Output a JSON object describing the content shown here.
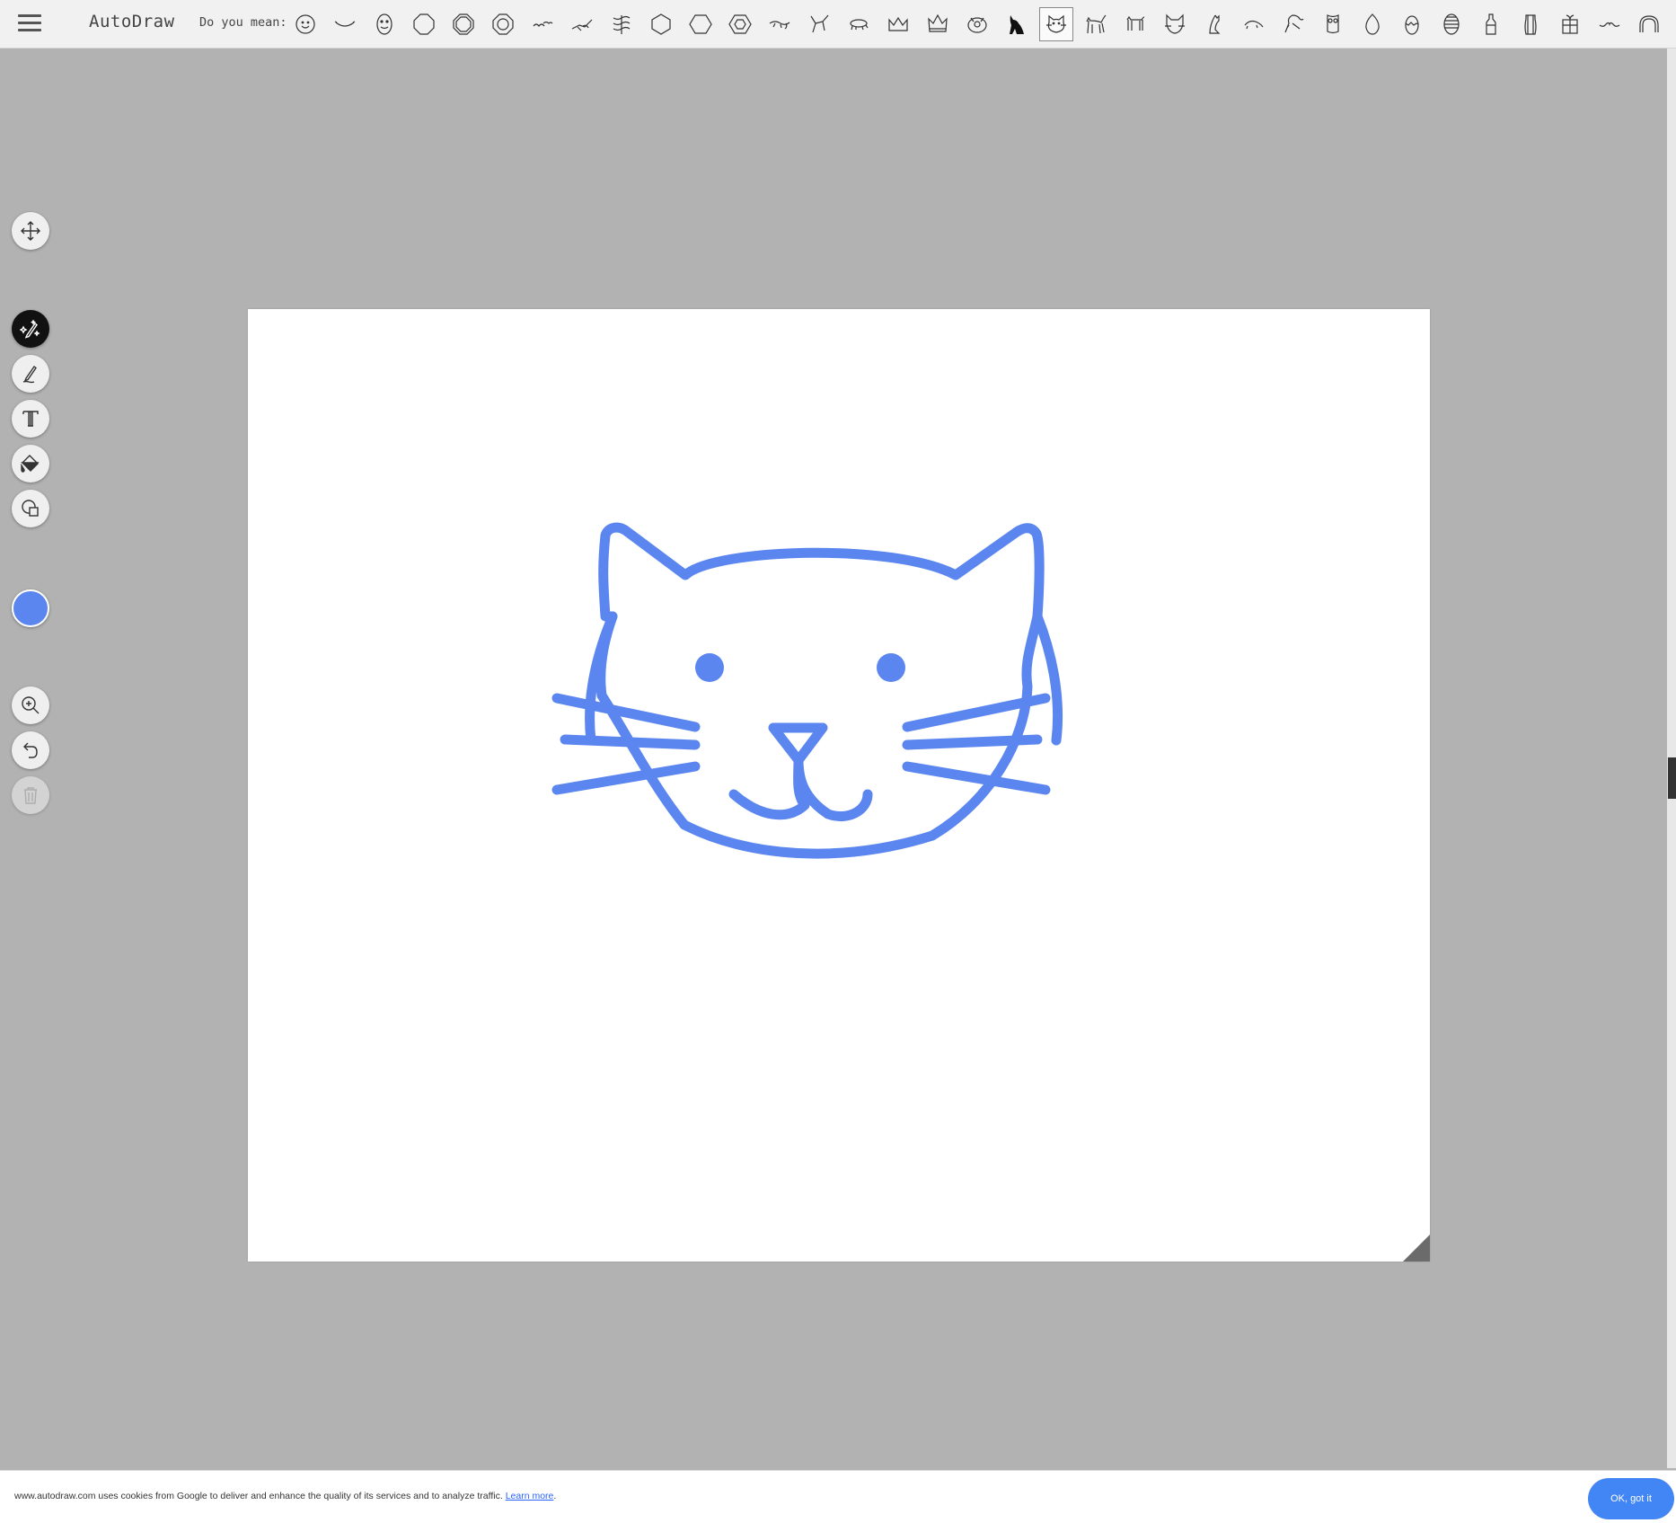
{
  "app": {
    "title": "AutoDraw"
  },
  "suggestions": {
    "label": "Do you mean:",
    "items": [
      {
        "icon": "smiley-face-icon"
      },
      {
        "icon": "smile-mouth-icon"
      },
      {
        "icon": "face-oval-icon"
      },
      {
        "icon": "octagon-icon"
      },
      {
        "icon": "double-octagon-icon"
      },
      {
        "icon": "concentric-octagon-icon"
      },
      {
        "icon": "birds-flying-icon"
      },
      {
        "icon": "bird-sketch-icon"
      },
      {
        "icon": "scribble-icon"
      },
      {
        "icon": "hexagon-icon"
      },
      {
        "icon": "hexagon-wide-icon"
      },
      {
        "icon": "concentric-hexagon-icon"
      },
      {
        "icon": "lizard-icon"
      },
      {
        "icon": "bird-wings-icon"
      },
      {
        "icon": "animal-running-icon"
      },
      {
        "icon": "crown-icon"
      },
      {
        "icon": "crown-ornate-icon"
      },
      {
        "icon": "crown-jewel-icon"
      },
      {
        "icon": "cat-silhouette-icon"
      },
      {
        "icon": "cat-face-icon",
        "selected": true
      },
      {
        "icon": "cat-standing-icon"
      },
      {
        "icon": "dog-icon"
      },
      {
        "icon": "cat-face-alt-icon"
      },
      {
        "icon": "cat-sitting-icon"
      },
      {
        "icon": "mouse-icon"
      },
      {
        "icon": "dragon-icon"
      },
      {
        "icon": "owl-icon"
      },
      {
        "icon": "egg-icon"
      },
      {
        "icon": "egg-cracked-icon"
      },
      {
        "icon": "easter-egg-icon"
      },
      {
        "icon": "bottle-icon"
      },
      {
        "icon": "jar-icon"
      },
      {
        "icon": "gift-icon"
      },
      {
        "icon": "mustache-icon"
      },
      {
        "icon": "arch-icon"
      },
      {
        "icon": "tilde-icon"
      }
    ]
  },
  "tools": [
    {
      "icon": "move-icon"
    },
    {
      "icon": "autodraw-icon",
      "active": true
    },
    {
      "icon": "pencil-icon"
    },
    {
      "icon": "text-icon"
    },
    {
      "icon": "fill-bucket-icon"
    },
    {
      "icon": "shapes-icon"
    },
    {
      "icon": "zoom-icon"
    },
    {
      "icon": "undo-icon"
    },
    {
      "icon": "trash-icon",
      "disabled": true
    }
  ],
  "current_color": "#5b86ef",
  "canvas": {
    "background": "#ffffff",
    "drawing": "cat-face"
  },
  "cookie_banner": {
    "text": "www.autodraw.com uses cookies from Google to deliver and enhance the quality of its services and to analyze traffic.",
    "link": "Learn more",
    "period": ".",
    "button": "OK, got it"
  }
}
